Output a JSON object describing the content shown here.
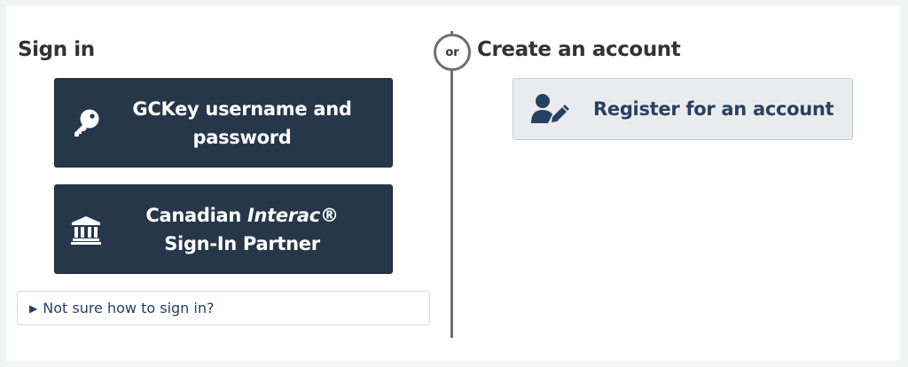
{
  "sign_in": {
    "heading": "Sign in",
    "gckey_button": {
      "label": "GCKey username and password",
      "icon": "key-icon"
    },
    "interac_button": {
      "label_before": "Canadian ",
      "label_brand": "Interac",
      "label_after": "® Sign-In Partner",
      "icon": "bank-icon"
    },
    "help_toggle": {
      "label": "Not sure how to sign in?"
    }
  },
  "divider": {
    "label": "or"
  },
  "create_account": {
    "heading": "Create an account",
    "register_button": {
      "label": "Register for an account",
      "icon": "user-edit-icon"
    }
  },
  "colors": {
    "primary_dark": "#26374a",
    "link_blue": "#284162",
    "secondary_bg": "#eaebed",
    "divider_gray": "#6f6f6f"
  }
}
